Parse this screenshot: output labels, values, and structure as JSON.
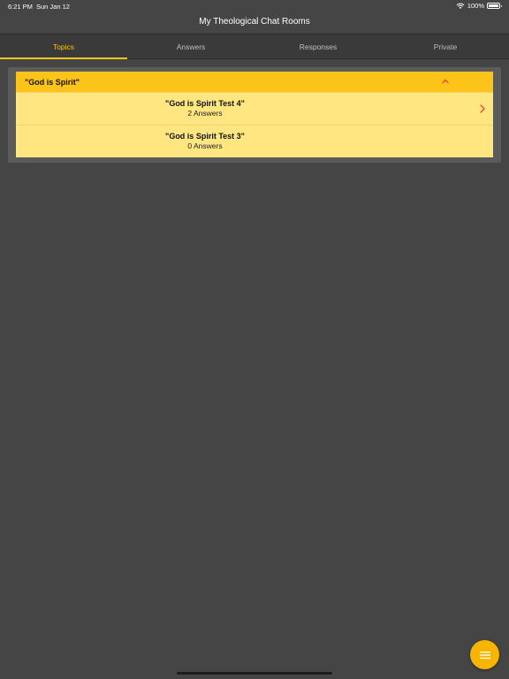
{
  "status_bar": {
    "time": "6:21 PM",
    "date": "Sun Jan 12",
    "battery": "100%"
  },
  "header": {
    "title": "My Theological Chat Rooms"
  },
  "tabs": [
    {
      "label": "Topics",
      "active": true
    },
    {
      "label": "Answers",
      "active": false
    },
    {
      "label": "Responses",
      "active": false
    },
    {
      "label": "Private",
      "active": false
    }
  ],
  "topic_group": {
    "title": "\"God is Spirit\"",
    "expanded": true,
    "items": [
      {
        "title": "\"God is Spirit Test 4\"",
        "subtitle": "2 Answers",
        "has_chevron": true
      },
      {
        "title": "\"God is Spirit Test 3\"",
        "subtitle": "0 Answers",
        "has_chevron": false
      }
    ]
  },
  "colors": {
    "background": "#454545",
    "accent": "#f5c518",
    "group_header": "#fcc419",
    "row_background": "#ffe680",
    "chevron": "#e8452f",
    "fab": "#f7b500"
  },
  "icons": {
    "wifi": "wifi-icon",
    "battery": "battery-icon",
    "collapse": "chevron-up-icon",
    "row_disclosure": "chevron-right-icon",
    "fab": "menu-icon"
  }
}
